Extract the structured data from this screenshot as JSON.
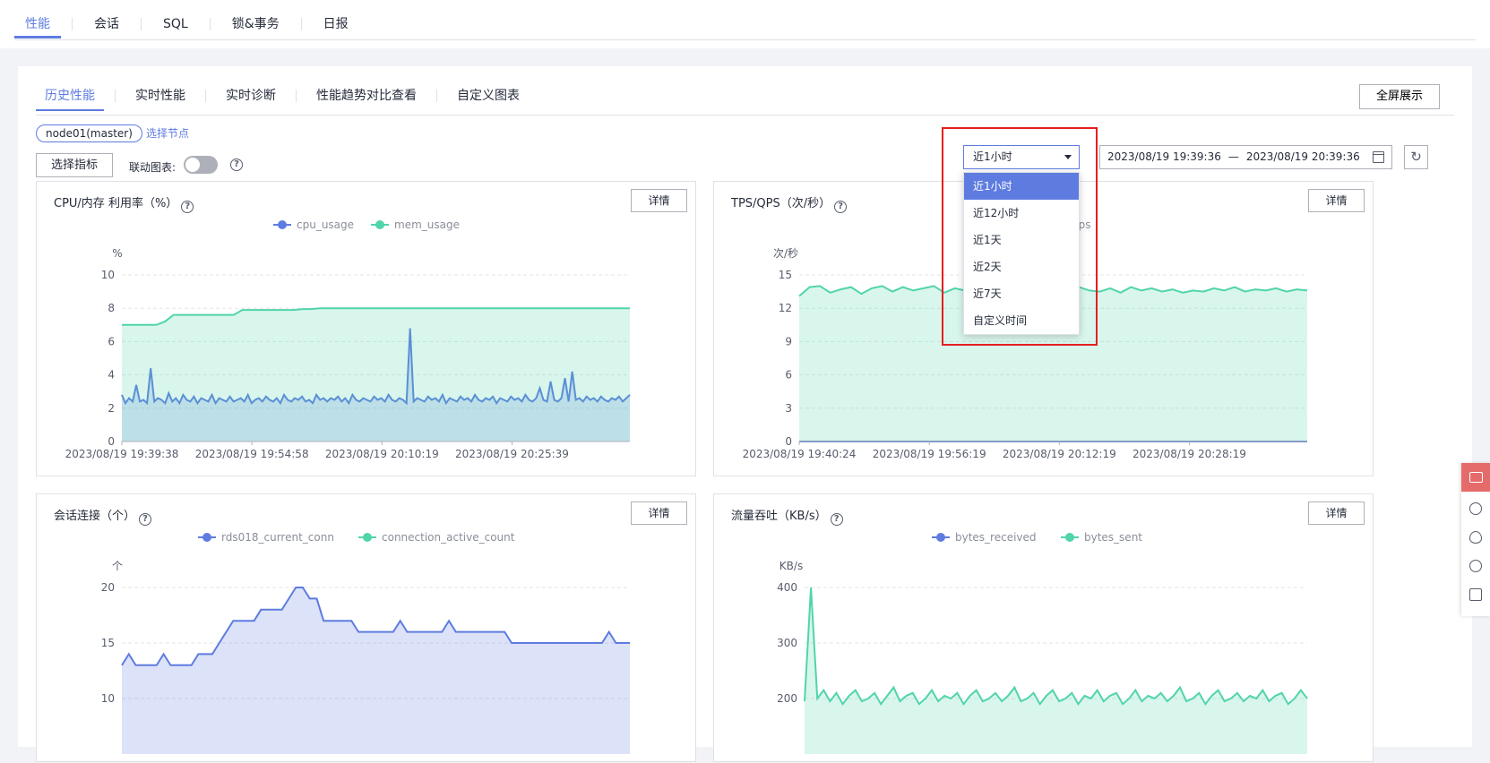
{
  "top_tabs": [
    "性能",
    "会话",
    "SQL",
    "锁&事务",
    "日报"
  ],
  "sub_tabs": [
    "历史性能",
    "实时性能",
    "实时诊断",
    "性能趋势对比查看",
    "自定义图表"
  ],
  "fullscreen_label": "全屏展示",
  "node_tag": "node01(master)",
  "select_node_label": "选择节点",
  "select_metric_label": "选择指标",
  "link_chart_label": "联动图表:",
  "range_value": "近1小时",
  "range_options": [
    "近1小时",
    "近12小时",
    "近1天",
    "近2天",
    "近7天",
    "自定义时间"
  ],
  "date_start": "2023/08/19 19:39:36",
  "date_sep": "—",
  "date_end": "2023/08/19 20:39:36",
  "detail_label": "详情",
  "colors": {
    "accent": "#5e7ce0",
    "series1": "#5e7ce0",
    "series2": "#50d4ab",
    "highlight_box": "#e51e1e"
  },
  "icons": [
    "help-icon",
    "calendar-icon",
    "refresh-icon",
    "caret-down-icon",
    "feedback-icon",
    "smile-icon",
    "eye-icon",
    "question-icon",
    "checklist-icon"
  ],
  "chart_data": [
    {
      "type": "area",
      "title": "CPU/内存 利用率（%）",
      "ylabel": "%",
      "ylim": [
        0,
        10
      ],
      "yticks": [
        0,
        2,
        4,
        6,
        8,
        10
      ],
      "xtick_labels": [
        "2023/08/19 19:39:38",
        "2023/08/19 19:54:58",
        "2023/08/19 20:10:19",
        "2023/08/19 20:25:39"
      ],
      "series": [
        {
          "name": "cpu_usage",
          "values": [
            2.8,
            2.3,
            2.6,
            2.4,
            3.4,
            2.4,
            2.5,
            2.3,
            4.4,
            2.4,
            2.6,
            2.5,
            2.3,
            2.9,
            2.4,
            2.6,
            2.3,
            2.8,
            2.5,
            2.4,
            2.7,
            2.3,
            2.6,
            2.5,
            2.4,
            2.8,
            2.3,
            2.6,
            2.5,
            2.4,
            2.7,
            2.4,
            2.5,
            2.6,
            2.4,
            2.8,
            2.3,
            2.5,
            2.6,
            2.4,
            2.7,
            2.5,
            2.4,
            2.6,
            2.3,
            2.8,
            2.5,
            2.4,
            2.6,
            2.5,
            2.7,
            2.4,
            2.5,
            2.3,
            2.8,
            2.5,
            2.6,
            2.4,
            2.6,
            2.5,
            2.7,
            2.4,
            2.6,
            2.3,
            2.8,
            2.5,
            2.4,
            2.6,
            2.5,
            2.4,
            2.7,
            2.5,
            2.6,
            2.4,
            2.8,
            2.5,
            2.4,
            2.6,
            2.5,
            2.3,
            6.8,
            2.4,
            2.6,
            2.5,
            2.4,
            2.7,
            2.5,
            2.6,
            2.4,
            2.8,
            2.3,
            2.6,
            2.5,
            2.4,
            2.7,
            2.5,
            2.6,
            2.4,
            2.8,
            2.5,
            2.4,
            2.6,
            2.5,
            2.7,
            2.3,
            2.6,
            2.5,
            2.4,
            2.7,
            2.5,
            2.6,
            2.4,
            2.8,
            2.5,
            2.4,
            2.6,
            3.2,
            2.5,
            2.4,
            3.6,
            2.5,
            2.4,
            2.6,
            3.8,
            2.4,
            4.2,
            2.5,
            2.6,
            2.4,
            2.7,
            2.5,
            2.6,
            2.4,
            2.7,
            2.5,
            2.4,
            2.6,
            2.5,
            2.7,
            2.4,
            2.6,
            2.8
          ]
        },
        {
          "name": "mem_usage",
          "values": [
            7.0,
            7.0,
            7.0,
            7.0,
            7.0,
            7.2,
            7.6,
            7.6,
            7.6,
            7.6,
            7.6,
            7.6,
            7.6,
            7.6,
            7.9,
            7.9,
            7.9,
            7.9,
            7.9,
            7.9,
            7.9,
            7.95,
            7.95,
            8.0,
            8.0,
            8.0,
            8.0,
            8.0,
            8.0,
            8.0,
            8.0,
            8.0,
            8.0,
            8.0,
            8.0,
            8.0,
            8.0,
            8.0,
            8.0,
            8.0,
            8.0,
            8.0,
            8.0,
            8.0,
            8.0,
            8.0,
            8.0,
            8.0,
            8.0,
            8.0,
            8.0,
            8.0,
            8.0,
            8.0,
            8.0,
            8.0,
            8.0,
            8.0,
            8.0,
            8.0
          ]
        }
      ]
    },
    {
      "type": "area",
      "title": "TPS/QPS（次/秒）",
      "ylabel": "次/秒",
      "ylim": [
        0,
        15
      ],
      "yticks": [
        0,
        3,
        6,
        9,
        12,
        15
      ],
      "xtick_labels": [
        "2023/08/19 19:40:24",
        "2023/08/19 19:56:19",
        "2023/08/19 20:12:19",
        "2023/08/19 20:28:19"
      ],
      "series": [
        {
          "name": "tps",
          "values": [
            0,
            0,
            0,
            0,
            0,
            0,
            0,
            0,
            0,
            0
          ]
        },
        {
          "name": "qps",
          "values": [
            13.1,
            13.9,
            14.0,
            13.4,
            13.7,
            13.9,
            13.3,
            13.8,
            14.0,
            13.5,
            13.9,
            13.6,
            13.8,
            14.0,
            13.4,
            13.8,
            13.6,
            14.0,
            13.5,
            13.8,
            13.9,
            13.4,
            13.8,
            13.6,
            14.0,
            13.5,
            13.7,
            13.9,
            13.6,
            13.5,
            13.8,
            13.4,
            13.9,
            13.6,
            13.8,
            13.5,
            13.7,
            13.4,
            13.6,
            13.5,
            13.8,
            13.6,
            13.9,
            13.5,
            13.7,
            13.6,
            13.8,
            13.5,
            13.7,
            13.6
          ]
        }
      ]
    },
    {
      "type": "area",
      "title": "会话连接（个）",
      "ylabel": "个",
      "ylim": [
        5,
        20
      ],
      "yticks": [
        10,
        15,
        20
      ],
      "xtick_labels": [],
      "series": [
        {
          "name": "rds018_current_conn",
          "values": [
            13,
            14,
            13,
            13,
            13,
            13,
            14,
            13,
            13,
            13,
            13,
            14,
            14,
            14,
            15,
            16,
            17,
            17,
            17,
            17,
            18,
            18,
            18,
            18,
            19,
            20,
            20,
            19,
            19,
            17,
            17,
            17,
            17,
            17,
            16,
            16,
            16,
            16,
            16,
            16,
            17,
            16,
            16,
            16,
            16,
            16,
            16,
            17,
            16,
            16,
            16,
            16,
            16,
            16,
            16,
            16,
            15,
            15,
            15,
            15,
            15,
            15,
            15,
            15,
            15,
            15,
            15,
            15,
            15,
            15,
            16,
            15,
            15,
            15
          ]
        },
        {
          "name": "connection_active_count",
          "values": []
        }
      ]
    },
    {
      "type": "area",
      "title": "流量吞吐（KB/s）",
      "ylabel": "KB/s",
      "ylim": [
        100,
        400
      ],
      "yticks": [
        200,
        300,
        400
      ],
      "xtick_labels": [],
      "series": [
        {
          "name": "bytes_received",
          "values": []
        },
        {
          "name": "bytes_sent",
          "values": [
            195,
            400,
            200,
            215,
            195,
            210,
            190,
            205,
            215,
            195,
            200,
            210,
            190,
            205,
            220,
            195,
            205,
            210,
            190,
            200,
            215,
            195,
            205,
            200,
            210,
            190,
            205,
            215,
            195,
            200,
            210,
            195,
            205,
            220,
            195,
            200,
            210,
            190,
            205,
            215,
            195,
            200,
            210,
            190,
            205,
            200,
            215,
            195,
            205,
            210,
            190,
            200,
            215,
            195,
            205,
            200,
            210,
            195,
            205,
            220,
            195,
            200,
            210,
            190,
            205,
            215,
            195,
            200,
            210,
            195,
            205,
            200,
            215,
            195,
            205,
            210,
            190,
            200,
            215,
            200
          ]
        }
      ]
    }
  ]
}
